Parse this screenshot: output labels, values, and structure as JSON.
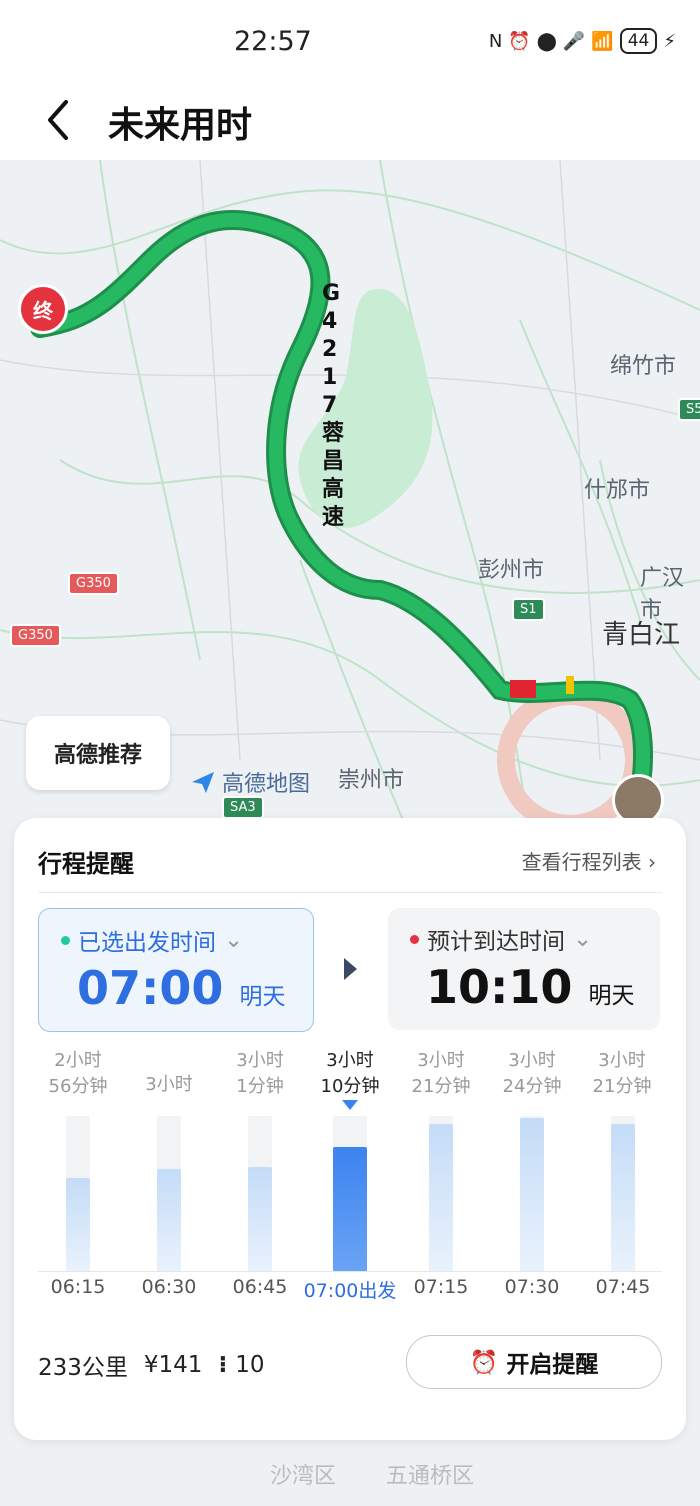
{
  "status": {
    "time": "22:57",
    "battery": "44"
  },
  "header": {
    "title": "未来用时"
  },
  "map": {
    "labels": [
      "绵竹市",
      "什邡市",
      "彭州市",
      "广汉市",
      "青白江",
      "崇州市",
      "沙湾区",
      "五通桥区"
    ],
    "road_badges": [
      "G350",
      "G350",
      "S1",
      "SA3",
      "S5"
    ],
    "route_name": "G4217蓉昌高速",
    "end_marker": "终",
    "brand": "高德地图"
  },
  "recommend": {
    "label": "高德推荐"
  },
  "panel": {
    "title": "行程提醒",
    "link": "查看行程列表",
    "departure": {
      "label": "已选出发时间",
      "time": "07:00",
      "day": "明天"
    },
    "arrival": {
      "label": "预计到达时间",
      "time": "10:10",
      "day": "明天"
    },
    "durations": [
      {
        "line1": "2小时",
        "line2": "56分钟"
      },
      {
        "line1": "3小时",
        "line2": ""
      },
      {
        "line1": "3小时",
        "line2": "1分钟"
      },
      {
        "line1": "3小时",
        "line2": "10分钟"
      },
      {
        "line1": "3小时",
        "line2": "21分钟"
      },
      {
        "line1": "3小时",
        "line2": "24分钟"
      },
      {
        "line1": "3小时",
        "line2": "21分钟"
      }
    ],
    "times": [
      "06:15",
      "06:30",
      "06:45",
      "07:00出发",
      "07:15",
      "07:30",
      "07:45"
    ],
    "distance": "233公里",
    "cost": "¥141",
    "traffic_lights": "10",
    "remind_button": "开启提醒"
  },
  "colors": {
    "accent": "#2f6ee0",
    "route": "#23b45e",
    "bar": "#c4dcf7",
    "bar_selected": "#3b83f0"
  }
}
